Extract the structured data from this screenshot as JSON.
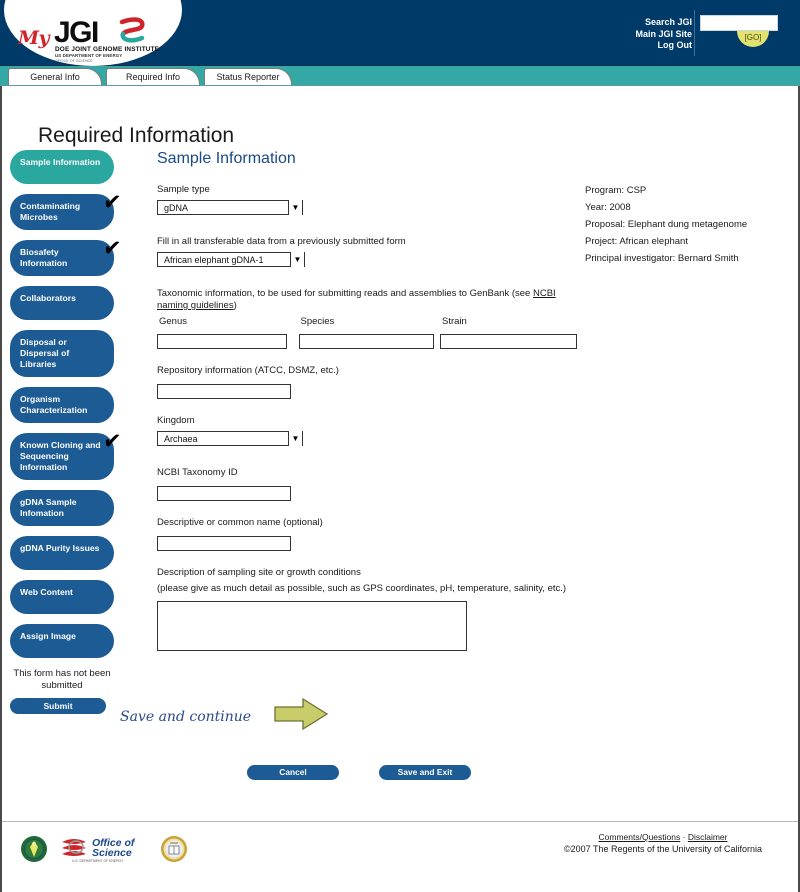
{
  "header": {
    "logo": {
      "my": "My",
      "jgi": "JGI",
      "line1": "DOE JOINT GENOME INSTITUTE",
      "line2": "US DEPARTMENT OF ENERGY",
      "line3": "OFFICE OF SCIENCE"
    },
    "links": [
      {
        "label": "Search JGI"
      },
      {
        "label": "Main JGI Site"
      },
      {
        "label": "Log Out"
      }
    ],
    "search_value": "",
    "search_placeholder": "",
    "go_label": "[GO]"
  },
  "tabs": [
    {
      "label": "General Info",
      "active": false
    },
    {
      "label": "Required Info",
      "active": true
    },
    {
      "label": "Status Reporter",
      "active": false
    }
  ],
  "page_title": "Required Information",
  "sidebar": {
    "items": [
      {
        "label": "Sample Information",
        "active": true,
        "checked": false
      },
      {
        "label": "Contaminating Microbes",
        "active": false,
        "checked": true
      },
      {
        "label": "Biosafety Information",
        "active": false,
        "checked": true
      },
      {
        "label": "Collaborators",
        "active": false,
        "checked": false
      },
      {
        "label": "Disposal or Dispersal of Libraries",
        "active": false,
        "checked": false
      },
      {
        "label": "Organism Characterization",
        "active": false,
        "checked": false
      },
      {
        "label": "Known Cloning and Sequencing Information",
        "active": false,
        "checked": true
      },
      {
        "label": "gDNA Sample Infomation",
        "active": false,
        "checked": false
      },
      {
        "label": "gDNA Purity Issues",
        "active": false,
        "checked": false
      },
      {
        "label": "Web Content",
        "active": false,
        "checked": false
      },
      {
        "label": "Assign Image",
        "active": false,
        "checked": false
      }
    ],
    "form_status": "This form has not been submitted",
    "submit_label": "Submit"
  },
  "main": {
    "section_title": "Sample Information",
    "sample_type": {
      "label": "Sample type",
      "value": "gDNA",
      "options": [
        "gDNA"
      ]
    },
    "transferable": {
      "label": "Fill in all transferable data from a previously submitted form",
      "value": "African elephant gDNA-1",
      "options": [
        "African elephant gDNA-1"
      ]
    },
    "taxonomic": {
      "label_pre": "Taxonomic information, to be used for submitting reads and assemblies to GenBank (see ",
      "link": "NCBI naming guidelines",
      "label_post": ")",
      "genus": {
        "label": "Genus",
        "value": ""
      },
      "species": {
        "label": "Species",
        "value": ""
      },
      "strain": {
        "label": "Strain",
        "value": ""
      }
    },
    "repository": {
      "label": "Repository information (ATCC, DSMZ, etc.)",
      "value": ""
    },
    "kingdom": {
      "label": "Kingdom",
      "value": "Archaea",
      "options": [
        "Archaea"
      ]
    },
    "taxonomy_id": {
      "label": "NCBI Taxonomy ID",
      "value": ""
    },
    "common_name": {
      "label": "Descriptive or common name (optional)",
      "value": ""
    },
    "description": {
      "label_line1": "Description of sampling site or growth conditions",
      "label_line2": "(please give as much detail as possible, such as GPS coordinates, pH, temperature, salinity, etc.)",
      "value": ""
    },
    "save_continue_label": "Save and continue"
  },
  "info_panel": [
    "Program: CSP",
    "Year: 2008",
    "Proposal: Elephant dung metagenome",
    "Project: African elephant",
    "Principal investigator: Bernard Smith"
  ],
  "bottom_buttons": [
    {
      "label": "Cancel"
    },
    {
      "label": "Save and Exit"
    }
  ],
  "footer": {
    "logos": [
      {
        "name": "doe-seal"
      },
      {
        "name": "office-of-science-logo",
        "text_line1": "Office of",
        "text_line2": "Science",
        "text_line3": "U.S. DEPARTMENT OF ENERGY"
      },
      {
        "name": "uc-seal"
      }
    ],
    "links": [
      {
        "label": "Comments/Questions"
      },
      {
        "label": "Disclaimer"
      }
    ],
    "link_separator": " · ",
    "copyright": "©2007 The Regents of the University of California"
  },
  "colors": {
    "header_navy": "#003a68",
    "teal_band": "#33a8a5",
    "nav_blue": "#1d5b94",
    "nav_active_teal": "#2aa8a0",
    "section_title_blue": "#1a4a8a",
    "arrow_olive": "#c9cc6b",
    "go_yellow": "#e2e26e"
  }
}
